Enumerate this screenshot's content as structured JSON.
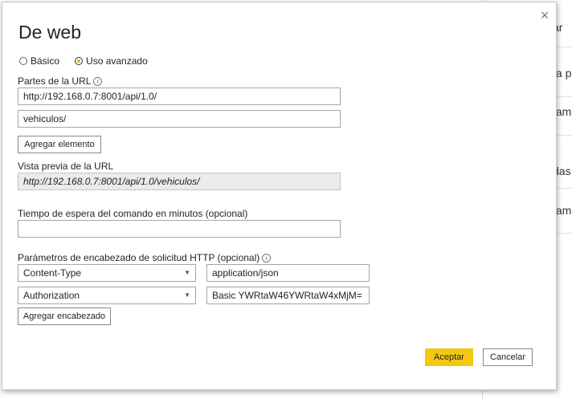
{
  "background": {
    "fragments": [
      "ar",
      "ta p",
      "tam",
      "das",
      "tam"
    ]
  },
  "dialog": {
    "title": "De web",
    "close_glyph": "×",
    "mode": {
      "basic_label": "Básico",
      "advanced_label": "Uso avanzado",
      "selected": "advanced"
    },
    "url_parts": {
      "label": "Partes de la URL",
      "part1": "http://192.168.0.7:8001/api/1.0/",
      "part2": "vehiculos/",
      "add_button": "Agregar elemento"
    },
    "preview": {
      "label": "Vista previa de la URL",
      "value": "http://192.168.0.7:8001/api/1.0/vehiculos/"
    },
    "timeout": {
      "label": "Tiempo de espera del comando en minutos (opcional)",
      "value": ""
    },
    "headers": {
      "label": "Parámetros de encabezado de solicitud HTTP (opcional)",
      "rows": [
        {
          "name": "Content-Type",
          "value": "application/json"
        },
        {
          "name": "Authorization",
          "value": "Basic YWRtaW46YWRtaW4xMjM="
        }
      ],
      "add_button": "Agregar encabezado"
    },
    "ok_button": "Aceptar",
    "cancel_button": "Cancelar"
  },
  "colors": {
    "accent": "#f2c811",
    "border": "#a6a6a6"
  }
}
